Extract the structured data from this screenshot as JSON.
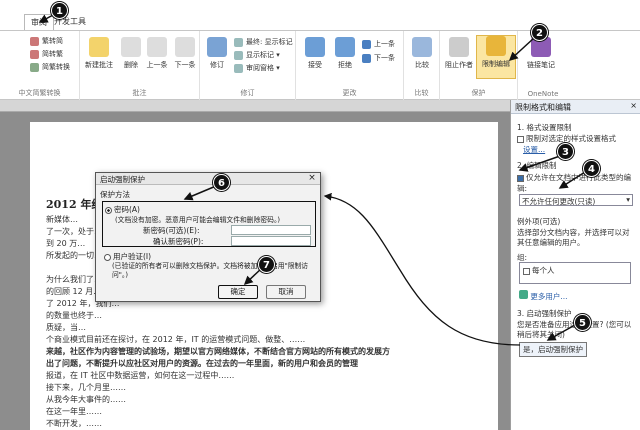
{
  "tabs": [
    {
      "label": "审阅"
    },
    {
      "label": "开发工具"
    }
  ],
  "ribbon": {
    "chinese_group": {
      "items": [
        "繁转简",
        "简转繁",
        "简繁转换"
      ],
      "label": "中文简繁转换"
    },
    "comments_group": {
      "items": [
        "新建批注",
        "删除",
        "上一条",
        "下一条"
      ],
      "label": "批注"
    },
    "track_group": {
      "items": [
        "修订",
        "最终: 显示标记",
        "显示标记 ▾",
        "审阅窗格 ▾"
      ],
      "label": "修订"
    },
    "changes_group": {
      "items": [
        "接受",
        "拒绝",
        "上一条",
        "下一条"
      ],
      "label": "更改"
    },
    "compare_group": {
      "items": [
        "比较"
      ],
      "label": "比较"
    },
    "protect_group": {
      "items": [
        "阻止作者",
        "限制编辑"
      ],
      "label": "保护"
    },
    "onenote_group": {
      "items": [
        "链接笔记"
      ],
      "label": "OneNote"
    }
  },
  "pane": {
    "title": "限制格式和编辑",
    "s1": "1. 格式设置限制",
    "s1_chk": "限制对选定的样式设置格式",
    "s1_link": "设置...",
    "s2": "2. 编辑限制",
    "s2_chk": "仅允许在文档中进行此类型的编辑:",
    "s2_select": "不允许任何更改(只读)",
    "exceptions": "例外项(可选)",
    "exc_desc": "选择部分文档内容，并选择可以对其任意编辑的用户。",
    "groups_label": "组:",
    "everyone": "每个人",
    "more_users": "更多用户...",
    "s3": "3. 启动强制保护",
    "s3_desc": "您是否准备应用这些设置? (您可以稍后将其关闭)",
    "start_btn": "是，启动强制保护"
  },
  "doc": {
    "title": "2012 年终",
    "lines": [
      "新媒体…",
      "了一次，处于…",
      "到 20 万…",
      "所发起的一切…",
      "为什么我们了…",
      "的回顾 12 月…",
      "了 2012 年，我们…",
      "的数量也终于…",
      "质疑，当…",
      "个商业模式目前还在探讨，在 2012 年，IT 的运营模式问题、做整、……",
      "来越，社区作为内容管理的试验场，期望以官方网络媒体，不断结合官方网站的所有模式的发展方",
      "出了问题，不断提升以应社区对用户的资源。在过去的一年里面，新的用户和会员的管理",
      "报道，在 IT 社区中数据运营，如何在这一过程中……",
      "接下来，几个月里……",
      "从我今年大事件的……",
      "在这一年里……",
      "不断开发，……"
    ]
  },
  "dialog": {
    "title": "启动强制保护",
    "method": "保护方法",
    "pwd_opt": "密码(A)",
    "pwd_desc": "(文档没有加密。恶意用户可能会编辑文件和删除密码。)",
    "new_pwd": "新密码(可选)(E):",
    "confirm_pwd": "确认新密码(P):",
    "user_opt": "用户验证(I)",
    "user_desc": "(已验证的所有者可以删除文档保护。文档将被加密并启用\"限制访问\"。)",
    "ok": "确定",
    "cancel": "取消"
  },
  "badges": [
    "1",
    "2",
    "3",
    "4",
    "5",
    "6",
    "7"
  ]
}
